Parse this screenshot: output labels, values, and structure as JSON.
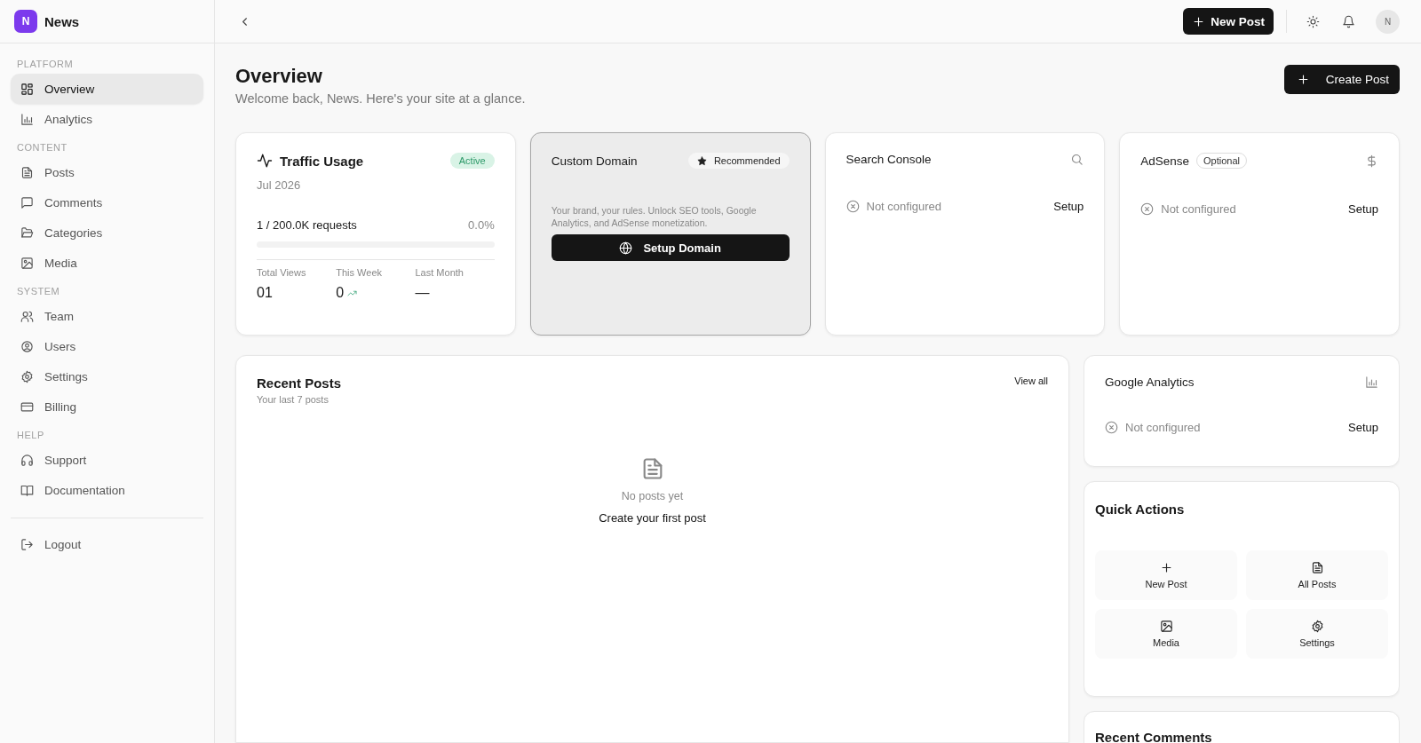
{
  "brand": {
    "initial": "N",
    "name": "News"
  },
  "sidebar": {
    "sections": [
      {
        "heading": "PLATFORM",
        "items": [
          {
            "label": "Overview",
            "selected": true
          },
          {
            "label": "Analytics",
            "selected": false
          }
        ]
      },
      {
        "heading": "CONTENT",
        "items": [
          {
            "label": "Posts",
            "selected": false
          },
          {
            "label": "Comments",
            "selected": false
          },
          {
            "label": "Categories",
            "selected": false
          },
          {
            "label": "Media",
            "selected": false
          }
        ]
      },
      {
        "heading": "SYSTEM",
        "items": [
          {
            "label": "Team",
            "selected": false
          },
          {
            "label": "Users",
            "selected": false
          },
          {
            "label": "Settings",
            "selected": false
          },
          {
            "label": "Billing",
            "selected": false
          }
        ]
      },
      {
        "heading": "HELP",
        "items": [
          {
            "label": "Support",
            "selected": false
          },
          {
            "label": "Documentation",
            "selected": false
          }
        ]
      }
    ],
    "logout": "Logout"
  },
  "header": {
    "new_post": "New Post",
    "avatar": "N"
  },
  "page": {
    "title": "Overview",
    "subtitle": "Welcome back, News. Here's your site at a glance.",
    "create_button": "Create Post"
  },
  "traffic": {
    "title": "Traffic Usage",
    "badge": "Active",
    "period": "Jul 2026",
    "usage": "1 / 200.0K requests",
    "percent": "0.0%",
    "level": 0,
    "stats": [
      {
        "label": "Total Views",
        "value": "01",
        "trend": false
      },
      {
        "label": "This Week",
        "value": "0",
        "trend": true
      },
      {
        "label": "Last Month",
        "value": "—",
        "trend": false
      }
    ]
  },
  "custom_domain": {
    "title": "Custom Domain",
    "badge": "Recommended",
    "description": "Your brand, your rules. Unlock SEO tools, Google Analytics, and AdSense monetization.",
    "button": "Setup Domain"
  },
  "integrations": [
    {
      "title": "Search Console",
      "status": "Not configured",
      "action": "Setup"
    },
    {
      "title": "AdSense",
      "badge": "Optional",
      "status": "Not configured",
      "action": "Setup"
    }
  ],
  "recent_posts": {
    "title": "Recent Posts",
    "subtitle": "Your last 7 posts",
    "view_all": "View all",
    "empty_title": "No posts yet",
    "empty_action": "Create your first post"
  },
  "google_analytics": {
    "title": "Google Analytics",
    "status": "Not configured",
    "action": "Setup"
  },
  "quick_actions": {
    "title": "Quick Actions",
    "items": [
      {
        "label": "New Post"
      },
      {
        "label": "All Posts"
      },
      {
        "label": "Media"
      },
      {
        "label": "Settings"
      }
    ]
  },
  "recent_comments": {
    "title": "Recent Comments"
  }
}
